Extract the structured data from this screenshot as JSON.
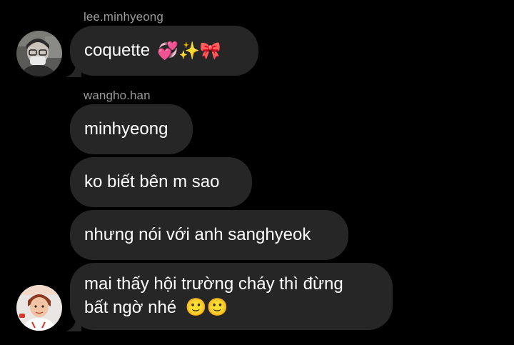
{
  "messages": [
    {
      "sender": "lee.minhyeong",
      "text": "coquette",
      "emoji": "💞✨🎀"
    },
    {
      "sender": "wangho.han",
      "text": "minhyeong"
    },
    {
      "text": "ko biết bên m sao"
    },
    {
      "text": "nhưng nói với anh sanghyeok"
    },
    {
      "line1": "mai thấy hội trường cháy thì đừng",
      "line2": "bất ngờ nhé",
      "emoji": "🙂🙂"
    }
  ],
  "avatars": {
    "lee_minhyeong": {
      "label": ""
    },
    "wangho_han": {
      "label": ""
    }
  },
  "colors": {
    "background": "#000000",
    "bubble": "#262626",
    "sender_name": "#9a9a9a",
    "text": "#ffffff"
  }
}
